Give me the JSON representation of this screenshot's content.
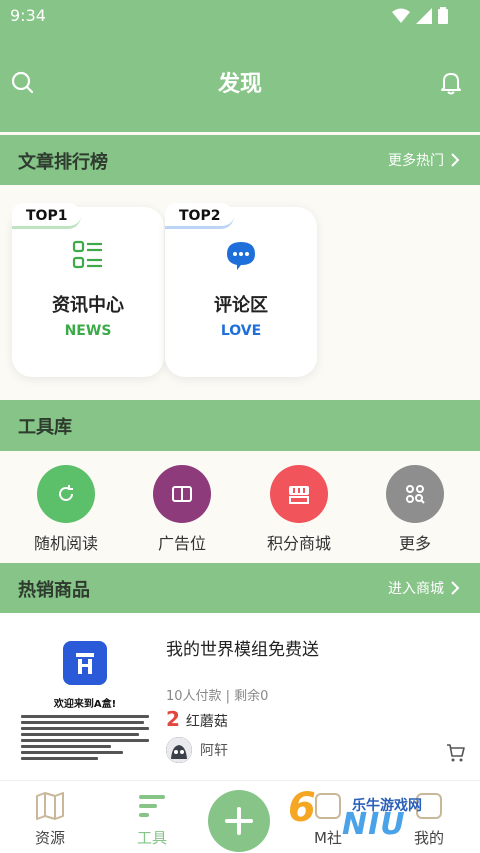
{
  "status_bar": {
    "time": "9:34",
    "icons": [
      "wifi-icon",
      "signal-icon",
      "battery-icon"
    ]
  },
  "header": {
    "title": "发现",
    "left_icon": "search-icon",
    "right_icon": "bell-icon"
  },
  "rank_section": {
    "title": "文章排行榜",
    "more": "更多热门",
    "cards": [
      {
        "badge": "TOP1",
        "name": "资讯中心",
        "sub": "NEWS",
        "icon": "list-icon",
        "color": "#3daa4a"
      },
      {
        "badge": "TOP2",
        "name": "评论区",
        "sub": "LOVE",
        "icon": "chat-bubble-icon",
        "color": "#1e6fd9"
      }
    ]
  },
  "tools_section": {
    "title": "工具库",
    "tools": [
      {
        "label": "随机阅读",
        "icon": "refresh-icon",
        "color": "#5cbf6a"
      },
      {
        "label": "广告位",
        "icon": "book-icon",
        "color": "#8e3b7c"
      },
      {
        "label": "积分商城",
        "icon": "shop-icon",
        "color": "#f1545a"
      },
      {
        "label": "更多",
        "icon": "grid-search-icon",
        "color": "#8e8e8e"
      }
    ]
  },
  "hot_section": {
    "title": "热销商品",
    "more": "进入商城",
    "product": {
      "thumb_title": "欢迎来到A盒!",
      "title": "我的世界模组免费送",
      "meta": "10人付款 | 剩余0",
      "price": "2",
      "unit": "红蘑菇",
      "seller": "阿轩"
    }
  },
  "bottom_nav": {
    "items": [
      {
        "label": "资源",
        "icon": "map-icon"
      },
      {
        "label": "工具",
        "icon": "tools-icon"
      },
      {
        "label": "M社",
        "icon": "community-icon"
      },
      {
        "label": "我的",
        "icon": "profile-icon"
      }
    ],
    "watermark": "乐牛游戏网"
  },
  "colors": {
    "primary": "#86c488",
    "background": "#fbfaf5",
    "price": "#e2463f"
  }
}
